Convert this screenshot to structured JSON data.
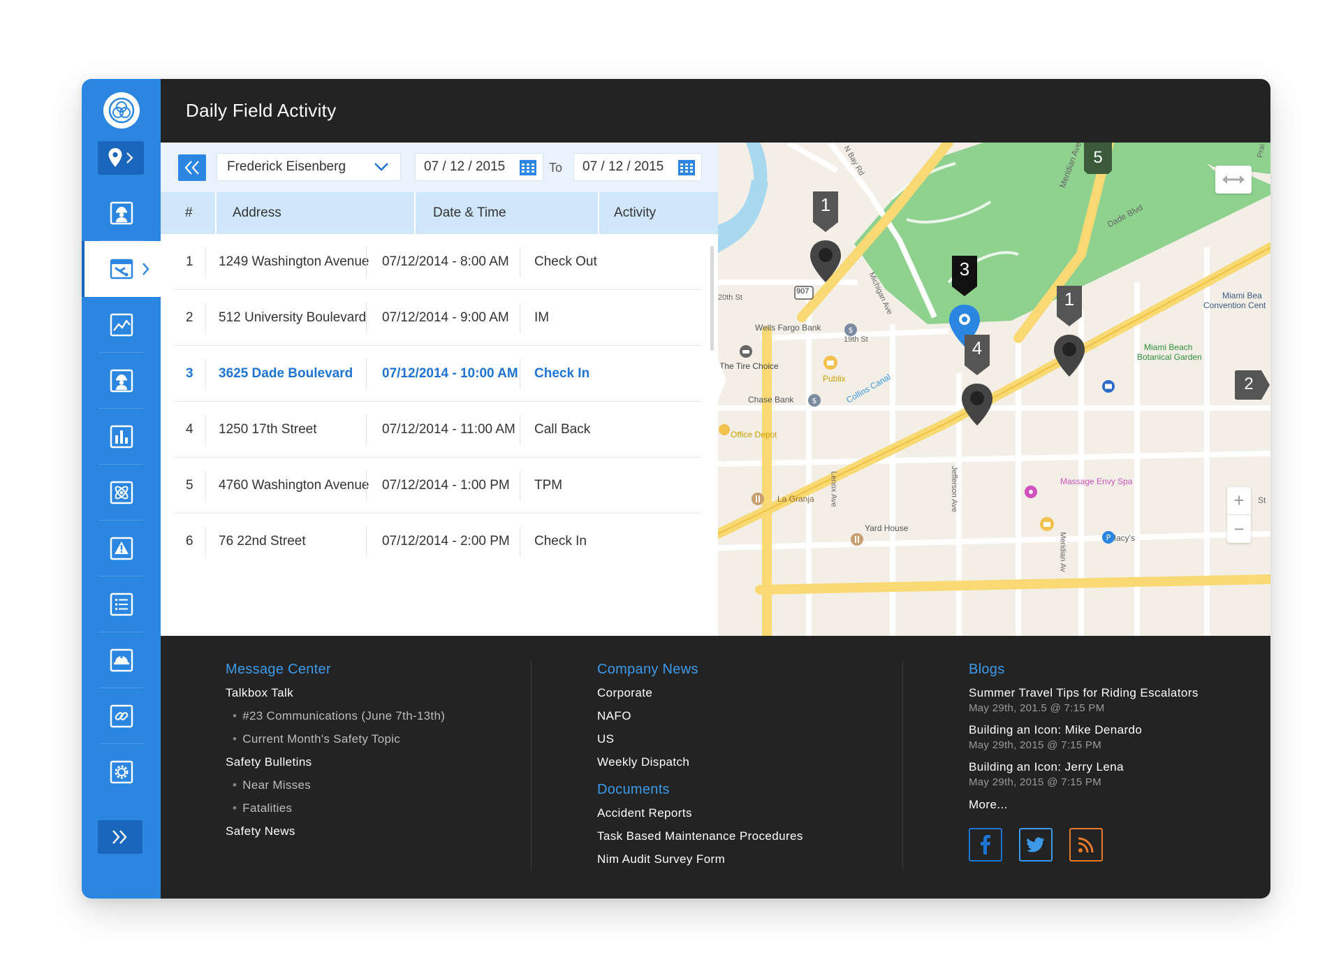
{
  "header": {
    "title": "Daily Field Activity"
  },
  "sidebar": {
    "items": [
      {
        "name": "worker-icon"
      },
      {
        "name": "tools-icon",
        "active": true
      },
      {
        "name": "trend-chart-icon"
      },
      {
        "name": "worker-icon"
      },
      {
        "name": "bar-chart-icon"
      },
      {
        "name": "atom-icon"
      },
      {
        "name": "warning-icon"
      },
      {
        "name": "list-icon"
      },
      {
        "name": "hard-hat-icon"
      },
      {
        "name": "link-icon"
      },
      {
        "name": "settings-icon"
      }
    ]
  },
  "filter": {
    "employee": "Frederick Eisenberg",
    "from_date": "07 / 12 / 2015",
    "to_label": "To",
    "to_date": "07 / 12 / 2015"
  },
  "table": {
    "columns": [
      "#",
      "Address",
      "Date & Time",
      "Activity"
    ],
    "rows": [
      {
        "num": "1",
        "address": "1249 Washington Avenue",
        "datetime": "07/12/2014 - 8:00 AM",
        "activity": "Check Out"
      },
      {
        "num": "2",
        "address": "512 University Boulevard",
        "datetime": "07/12/2014 - 9:00 AM",
        "activity": "IM"
      },
      {
        "num": "3",
        "address": "3625 Dade Boulevard",
        "datetime": "07/12/2014 - 10:00 AM",
        "activity": "Check In",
        "selected": true
      },
      {
        "num": "4",
        "address": "1250 17th Street",
        "datetime": "07/12/2014 - 11:00 AM",
        "activity": "Call Back"
      },
      {
        "num": "5",
        "address": "4760 Washington Avenue",
        "datetime": "07/12/2014 - 1:00 PM",
        "activity": "TPM"
      },
      {
        "num": "6",
        "address": "76 22nd Street",
        "datetime": "07/12/2014 - 2:00 PM",
        "activity": "Check In"
      }
    ]
  },
  "map": {
    "labels": {
      "n_bay_rd": "N Bay Rd",
      "meridian_ave_n": "Meridian Ave",
      "dade_blvd": "Dade Blvd",
      "prairie": "Prai",
      "st_20": "20th St",
      "st_19": "19th St",
      "route_907": "907",
      "michigan_ave": "Michigan Ave",
      "wells_fargo": "Wells Fargo Bank",
      "tire_choice": "The Tire Choice",
      "publix": "Publix",
      "collins_canal": "Collins Canal",
      "chase_bank": "Chase Bank",
      "office_depot": "Office Depot",
      "convention_1": "Miami Bea",
      "convention_2": "Convention Cent",
      "botanical_1": "Miami Beach",
      "botanical_2": "Botanical Garden",
      "lenox_ave": "Lenox Ave",
      "jefferson_ave": "Jefferson Ave",
      "meridian_ave_s": "Meridian Av",
      "massage_envy": "Massage Envy Spa",
      "la_granja": "La Granja",
      "st_right": "St",
      "yard_house": "Yard House",
      "macys": "Macy's"
    },
    "pins": [
      {
        "label": "1",
        "color": "#444444"
      },
      {
        "label": "3",
        "color": "#2a86e0"
      },
      {
        "label": "1",
        "color": "#444444"
      },
      {
        "label": "4",
        "color": "#444444"
      }
    ],
    "badges": {
      "five": "5",
      "two": "2"
    },
    "zoom_in": "+",
    "zoom_out": "−",
    "colors": {
      "park": "#8fd18f",
      "water": "#a8d8f0",
      "road_major": "#f9d973",
      "road_minor": "#ffffff"
    }
  },
  "footer": {
    "message_center": {
      "title": "Message Center",
      "group1": "Talkbox Talk",
      "sub1": [
        "#23 Communications (June 7th-13th)",
        "Current Month's Safety Topic"
      ],
      "group2": "Safety Bulletins",
      "sub2": [
        "Near Misses",
        "Fatalities"
      ],
      "group3": "Safety News"
    },
    "company_news": {
      "title": "Company News",
      "items": [
        "Corporate",
        "NAFO",
        "US",
        "Weekly Dispatch"
      ]
    },
    "documents": {
      "title": "Documents",
      "items": [
        "Accident Reports",
        "Task Based Maintenance Procedures",
        "Nim Audit Survey Form"
      ]
    },
    "blogs": {
      "title": "Blogs",
      "items": [
        {
          "title": "Summer Travel Tips for Riding Escalators",
          "date": "May 29th, 201.5 @ 7:15 PM"
        },
        {
          "title": "Building an Icon: Mike Denardo",
          "date": "May 29th, 2015 @ 7:15 PM"
        },
        {
          "title": "Building an Icon: Jerry Lena",
          "date": "May 29th, 2015 @ 7:15 PM"
        }
      ],
      "more": "More..."
    },
    "social": {
      "facebook": "#1d74d3",
      "twitter": "#3d9ae8",
      "rss": "#e8792b"
    }
  }
}
